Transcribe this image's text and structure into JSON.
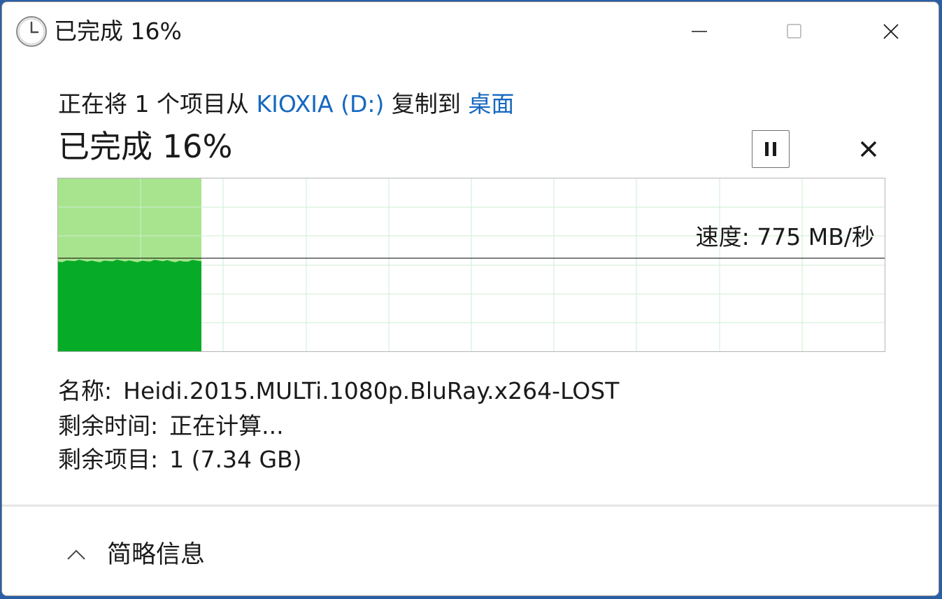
{
  "window": {
    "title": "已完成 16%",
    "controls": {
      "minimize_icon": "minimize-icon",
      "maximize_icon": "maximize-icon",
      "close_icon": "close-icon"
    },
    "icon": "clock-icon"
  },
  "copy": {
    "prefix": "正在将 1 个项目从 ",
    "source": "KIOXIA (D:)",
    "middle": " 复制到 ",
    "destination": "桌面"
  },
  "progress": {
    "label": "已完成 16%",
    "percent": 16,
    "pause_icon": "pause-icon",
    "cancel_icon": "cancel-icon"
  },
  "graph": {
    "speed_text": "速度: 775 MB/秒",
    "colors": {
      "filled_light": "#a8e48e",
      "filled_dark": "#06ab28",
      "grid": "#cdeed2",
      "speed_line": "#000000"
    }
  },
  "details": {
    "name_label": "名称:",
    "name_value": "Heidi.2015.MULTi.1080p.BluRay.x264-LOST",
    "time_label": "剩余时间:",
    "time_value": "正在计算...",
    "items_label": "剩余项目:",
    "items_value": "1 (7.34 GB)"
  },
  "footer": {
    "less_info_label": "简略信息",
    "chevron_icon": "chevron-up-icon"
  }
}
